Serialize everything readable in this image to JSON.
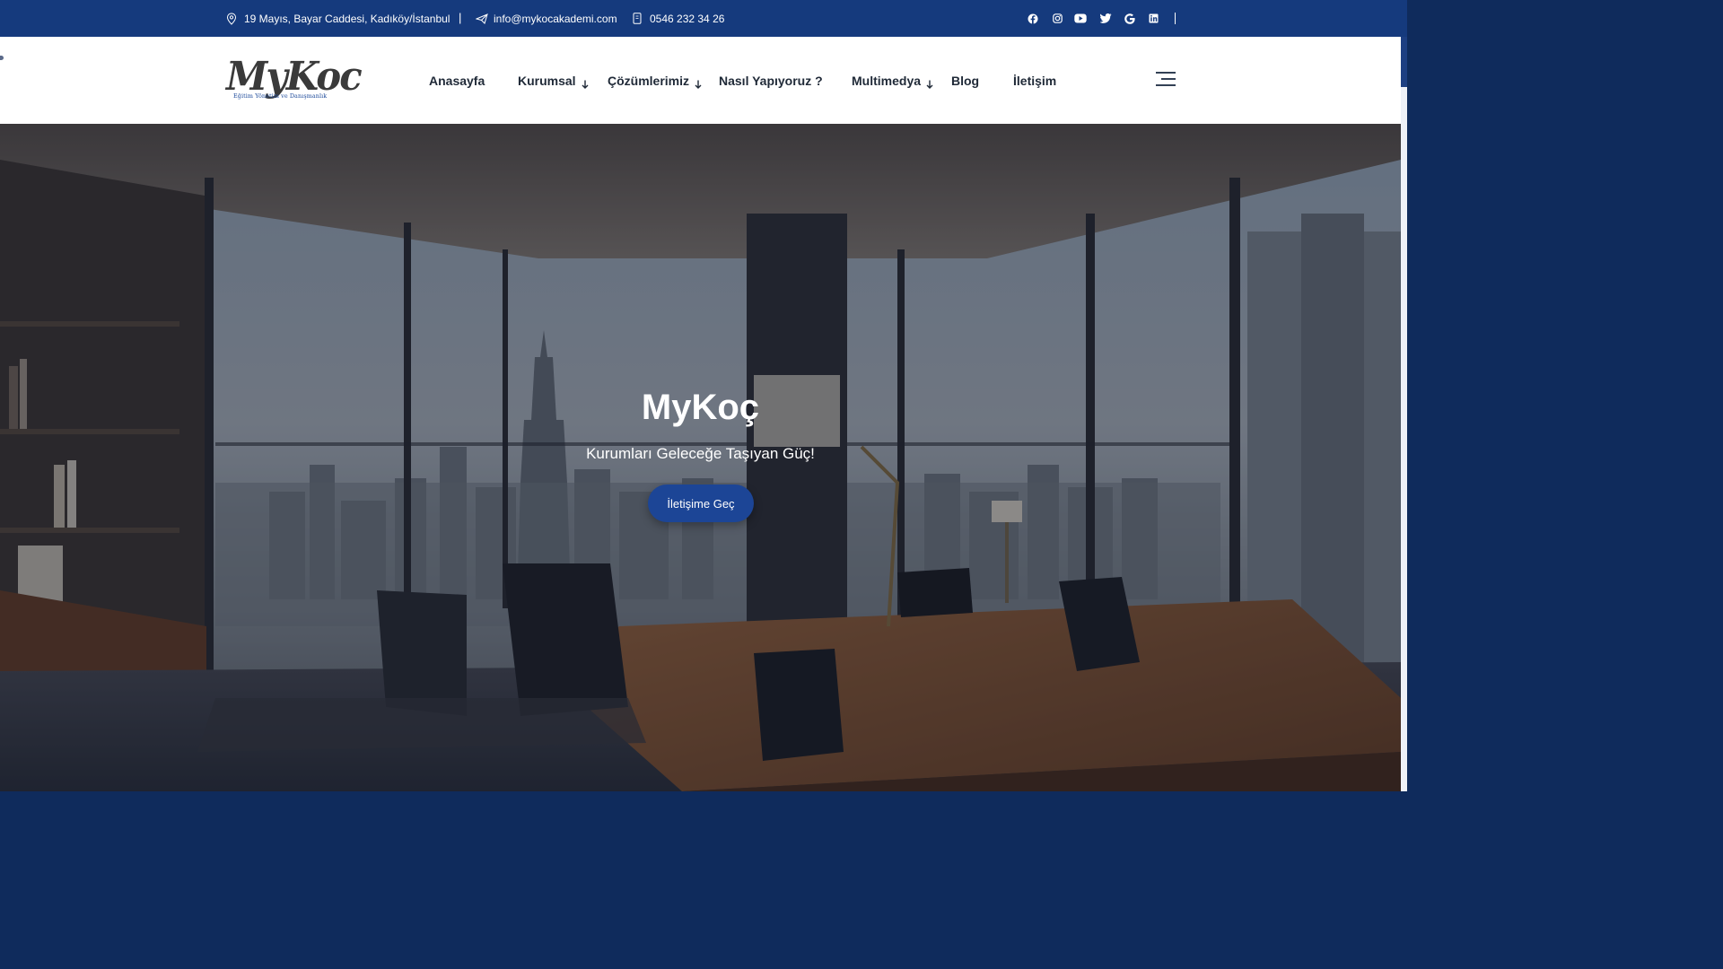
{
  "topbar": {
    "address": "19 Mayıs, Bayar Caddesi, Kadıköy/İstanbul",
    "separator": "|",
    "email": "info@mykocakademi.com",
    "phone": "0546 232 34 26",
    "social": [
      "facebook-icon",
      "instagram-icon",
      "youtube-icon",
      "twitter-icon",
      "google-icon",
      "linkedin-icon"
    ]
  },
  "logo": {
    "text": "MyKoc",
    "tagline": "Eğitim Yönetim ve Danışmanlık"
  },
  "nav": {
    "items": [
      {
        "label": "Anasayfa",
        "dropdown": false
      },
      {
        "label": "Kurumsal",
        "dropdown": true
      },
      {
        "label": "Çözümlerimiz",
        "dropdown": true
      },
      {
        "label": "Nasıl Yapıyoruz ?",
        "dropdown": false
      },
      {
        "label": "Multimedya",
        "dropdown": true
      },
      {
        "label": "Blog",
        "dropdown": false
      },
      {
        "label": "İletişim",
        "dropdown": false
      }
    ]
  },
  "hero": {
    "title": "MyKoç",
    "subtitle": "Kurumları Geleceğe Taşıyan Güç!",
    "cta_label": "İletişime Geç"
  },
  "colors": {
    "topbar_bg": "#153a7d",
    "primary": "#1c4596"
  }
}
